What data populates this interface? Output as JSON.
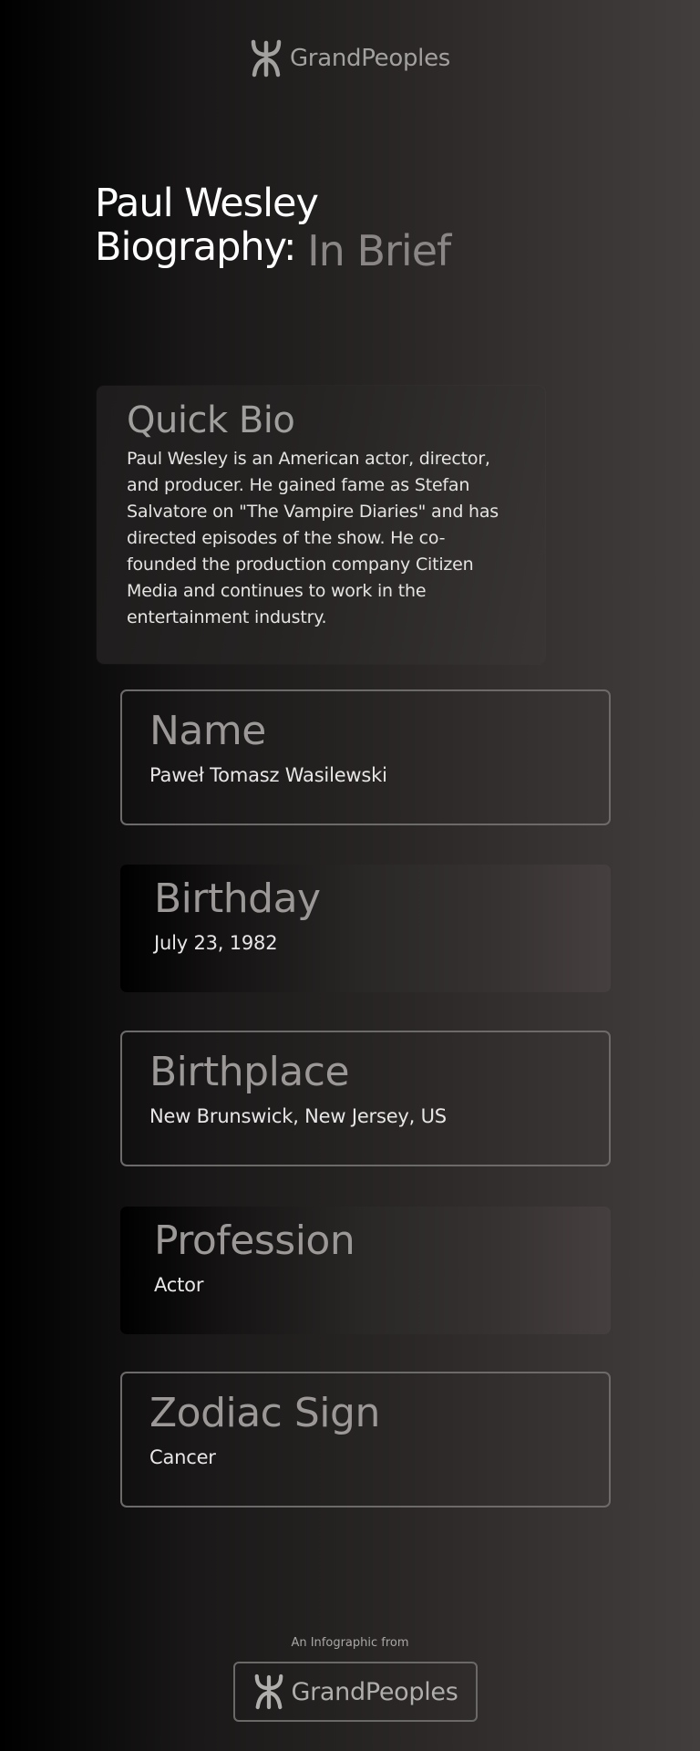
{
  "header": {
    "brand": "GrandPeoples",
    "logo_icon": "grandpeoples-logo-icon"
  },
  "hero": {
    "title_line1": "Paul Wesley",
    "title_line2": "Biography:",
    "title_accent": "In Brief"
  },
  "quick_bio": {
    "heading": "Quick Bio",
    "text": "Paul Wesley is an American actor, director, and producer. He gained fame as Stefan Salvatore on \"The Vampire Diaries\" and has directed episodes of the show. He co-founded the production company Citizen Media and continues to work in the entertainment industry."
  },
  "facts": [
    {
      "label": "Name",
      "value": "Paweł Tomasz Wasilewski"
    },
    {
      "label": "Birthday",
      "value": "July 23, 1982"
    },
    {
      "label": "Birthplace",
      "value": "New Brunswick, New Jersey, US"
    },
    {
      "label": "Profession",
      "value": "Actor"
    },
    {
      "label": "Zodiac Sign",
      "value": "Cancer"
    }
  ],
  "footer": {
    "caption": "An Infographic from",
    "brand": "GrandPeoples"
  },
  "colors": {
    "accent_gray": "#8a8686",
    "text_light": "#e6e3e3",
    "border": "#6d6a6a"
  }
}
